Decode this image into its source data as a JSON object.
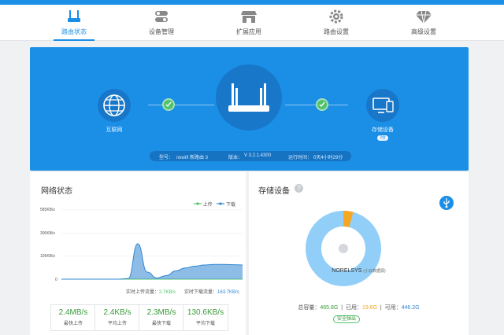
{
  "nav": {
    "items": [
      {
        "label": "路由状态",
        "icon": "router-icon",
        "active": true
      },
      {
        "label": "设备管理",
        "icon": "toggle-icon",
        "active": false
      },
      {
        "label": "扩展应用",
        "icon": "store-icon",
        "active": false
      },
      {
        "label": "路由设置",
        "icon": "gear-icon",
        "active": false
      },
      {
        "label": "高级设置",
        "icon": "diamond-icon",
        "active": false
      }
    ]
  },
  "hero": {
    "internet_label": "互联网",
    "storage_label": "存储设备",
    "storage_badge": "3台",
    "model_label": "型号：",
    "model_value": "newifi 新路由 3",
    "version_label": "版本：",
    "version_value": "V 3.2.1.4300",
    "uptime_label": "运行时间：",
    "uptime_value": "0天4小时29分"
  },
  "network": {
    "title": "网络状态",
    "legend_upload": "上传",
    "legend_download": "下载",
    "y_ticks": [
      "585KB/s",
      "300KB/s",
      "105KB/s",
      "0"
    ],
    "realtime_up_label": "实时上传流量：",
    "realtime_up_value": "2.7KB/s",
    "realtime_down_label": "实时下载流量：",
    "realtime_down_value": "163.7KB/s",
    "stats": [
      {
        "value": "2.4MB/s",
        "label": "最快上传"
      },
      {
        "value": "2.4KB/s",
        "label": "平均上传"
      },
      {
        "value": "2.3MB/s",
        "label": "最快下载"
      },
      {
        "value": "130.6KB/s",
        "label": "平均下载"
      }
    ]
  },
  "storage": {
    "title": "存储设备",
    "device_name": "NORELSYS",
    "device_sub": "(小云数据源)",
    "total_label": "总容量：",
    "total_value": "465.8G",
    "used_label": "已用：",
    "used_value": "19.6G",
    "free_label": "可用：",
    "free_value": "446.2G",
    "eject_label": "安全弹出"
  },
  "chart_data": {
    "type": "area",
    "title": "网络状态",
    "ylabel": "",
    "y_ticks": [
      "585KB/s",
      "300KB/s",
      "105KB/s",
      "0"
    ],
    "series": [
      {
        "name": "上传",
        "values": [
          0,
          0,
          0,
          0,
          0,
          0,
          0,
          0,
          0,
          0,
          0,
          0,
          0,
          0,
          0,
          0,
          0,
          0,
          0,
          0
        ]
      },
      {
        "name": "下载",
        "values": [
          0,
          0,
          0,
          0,
          0,
          0,
          0,
          5,
          300,
          60,
          10,
          30,
          70,
          95,
          110,
          120,
          125,
          125,
          122,
          120
        ]
      }
    ],
    "ylim": [
      0,
      585
    ],
    "colors": {
      "upload": "#4fc36b",
      "download": "#2f86d3"
    }
  },
  "colors": {
    "accent": "#1b8fe6",
    "check": "#4fc36b",
    "donut_free": "#92cff8",
    "donut_used": "#f5a623"
  }
}
